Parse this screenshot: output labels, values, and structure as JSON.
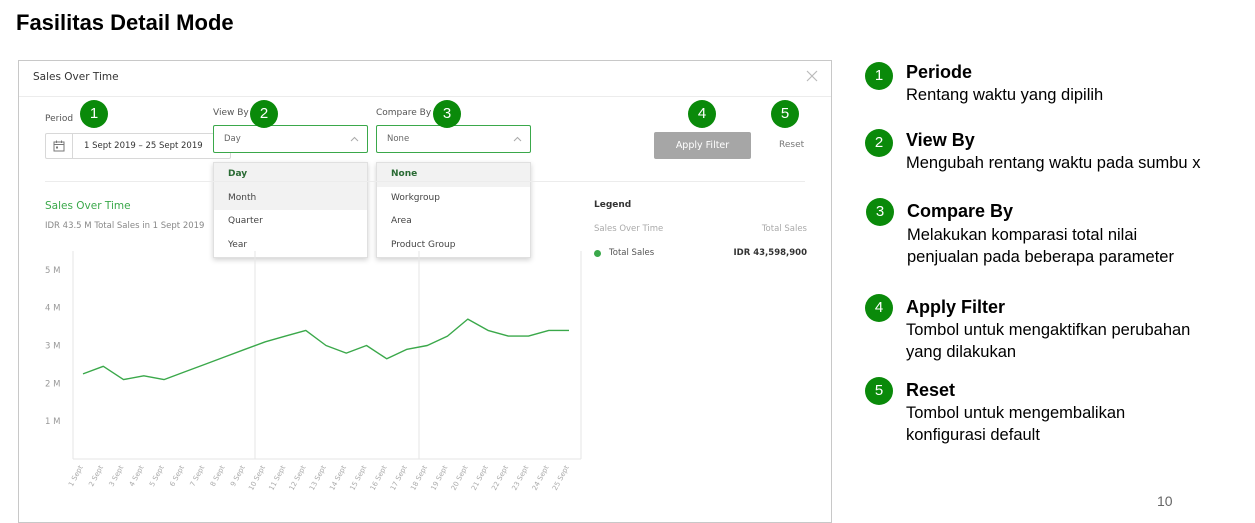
{
  "slide": {
    "title": "Fasilitas Detail Mode",
    "page_number": "10"
  },
  "panel": {
    "title": "Sales Over Time",
    "period": {
      "label": "Period",
      "value": "1 Sept 2019 – 25 Sept 2019"
    },
    "view_by": {
      "label": "View By",
      "value": "Day",
      "options": [
        "Day",
        "Month",
        "Quarter",
        "Year"
      ],
      "selected": "Day"
    },
    "compare_by": {
      "label": "Compare By",
      "value": "None",
      "options": [
        "None",
        "Workgroup",
        "Area",
        "Product Group"
      ],
      "selected": "None"
    },
    "apply_label": "Apply Filter",
    "reset_label": "Reset",
    "chart_title": "Sales Over Time",
    "chart_subtitle": "IDR 43.5 M Total Sales in 1 Sept 2019",
    "legend": {
      "title": "Legend",
      "col_left": "Sales Over Time",
      "col_right": "Total Sales",
      "row_name": "Total Sales",
      "row_value": "IDR 43,598,900",
      "color": "#3aa84a"
    }
  },
  "chart_data": {
    "type": "line",
    "title": "Sales Over Time",
    "y_ticks": [
      "1 M",
      "2 M",
      "3 M",
      "4 M",
      "5 M"
    ],
    "ylim": [
      0,
      5.5
    ],
    "x": [
      "1 Sept",
      "2 Sept",
      "3 Sept",
      "4 Sept",
      "5 Sept",
      "6 Sept",
      "7 Sept",
      "8 Sept",
      "9 Sept",
      "10 Sept",
      "11 Sept",
      "12 Sept",
      "13 Sept",
      "14 Sept",
      "15 Sept",
      "16 Sept",
      "17 Sept",
      "18 Sept",
      "19 Sept",
      "20 Sept",
      "21 Sept",
      "22 Sept",
      "23 Sept",
      "24 Sept",
      "25 Sept"
    ],
    "series": [
      {
        "values": [
          2.25,
          2.45,
          2.1,
          2.2,
          2.1,
          2.3,
          2.5,
          2.7,
          2.9,
          3.1,
          3.25,
          3.4,
          3.0,
          2.8,
          3.0,
          2.65,
          2.9,
          3.0,
          3.25,
          3.7,
          3.4,
          3.25,
          3.25,
          3.4,
          3.4
        ]
      }
    ],
    "grid": true,
    "line_color": "#3aa84a"
  },
  "callouts": [
    {
      "number": "1",
      "title": "Periode",
      "lines": [
        "Rentang waktu yang dipilih"
      ]
    },
    {
      "number": "2",
      "title": "View By",
      "lines": [
        "Mengubah rentang waktu pada sumbu x"
      ]
    },
    {
      "number": "3",
      "title": "Compare By",
      "lines": [
        "Melakukan komparasi total nilai",
        "penjualan pada beberapa parameter"
      ]
    },
    {
      "number": "4",
      "title": "Apply Filter",
      "lines": [
        "Tombol untuk mengaktifkan perubahan",
        "yang dilakukan"
      ]
    },
    {
      "number": "5",
      "title": "Reset",
      "lines": [
        "Tombol untuk mengembalikan",
        "konfigurasi default"
      ]
    }
  ],
  "badge_color": "#0a8a0a"
}
